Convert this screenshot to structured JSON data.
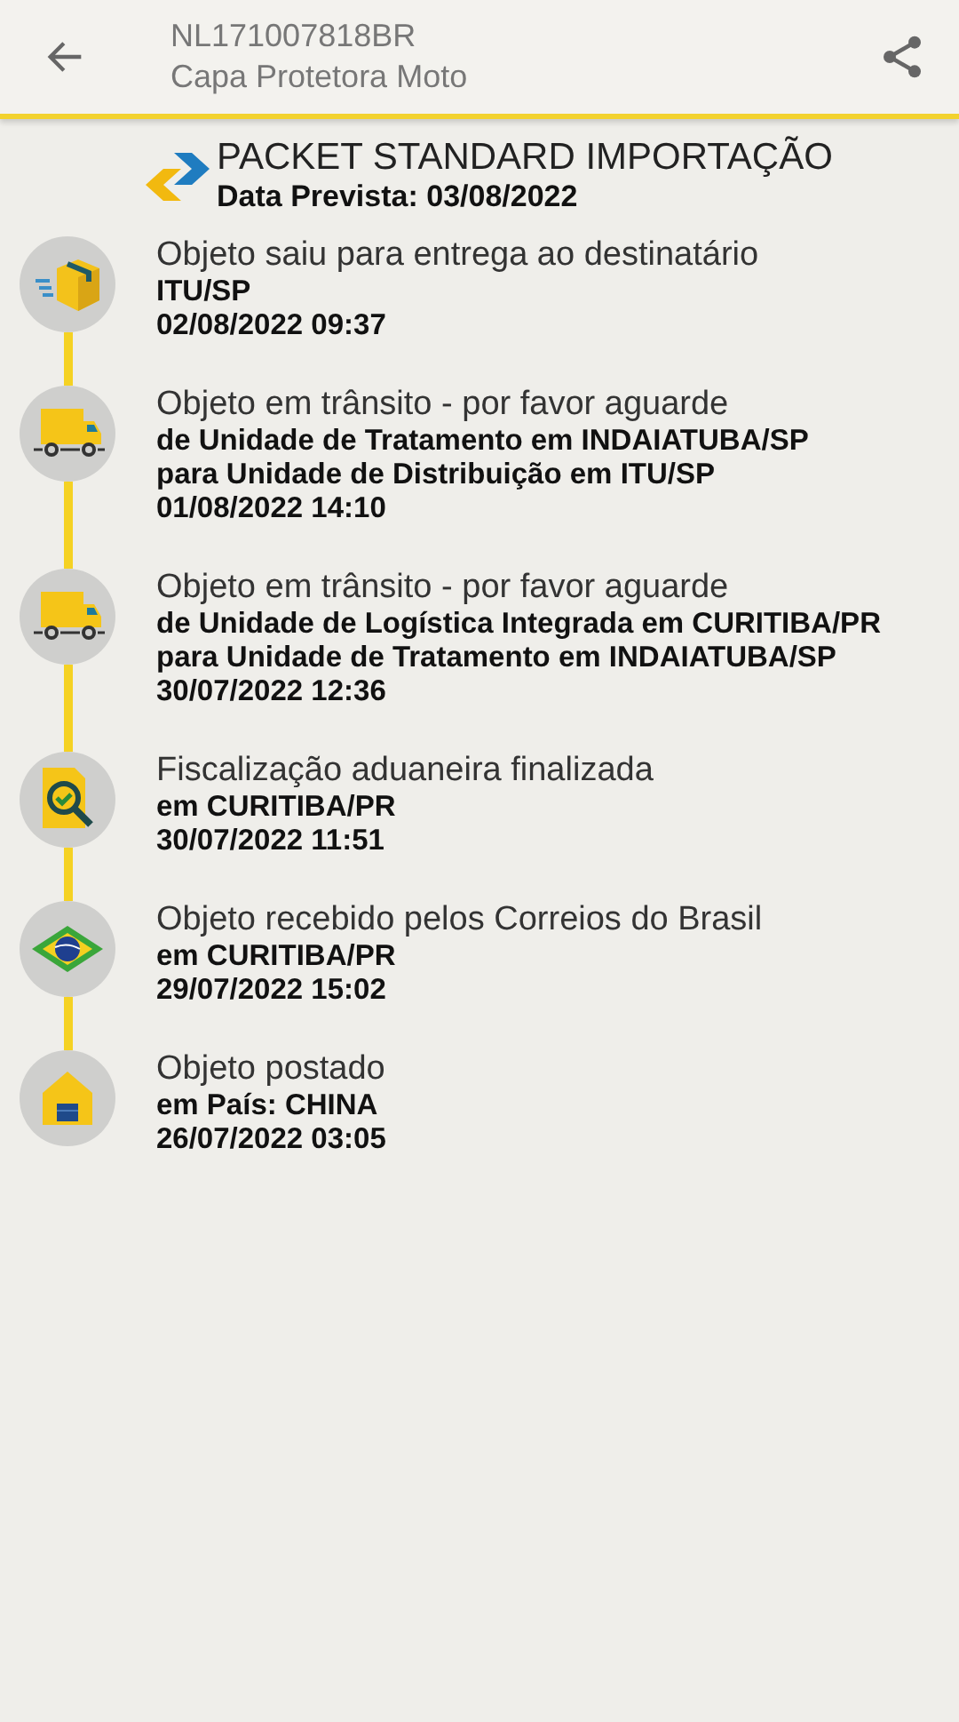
{
  "header": {
    "code": "NL171007818BR",
    "name": "Capa Protetora Moto"
  },
  "service": {
    "title": "PACKET STANDARD IMPORTAÇÃO",
    "forecast": "Data Prevista: 03/08/2022"
  },
  "events": [
    {
      "kind": "box",
      "title": "Objeto saiu para entrega ao destinatário",
      "lines": [
        "ITU/SP"
      ],
      "date": "02/08/2022 09:37"
    },
    {
      "kind": "truck",
      "title": "Objeto em trânsito - por favor aguarde",
      "lines": [
        "de Unidade de Tratamento em INDAIATUBA/SP",
        "para Unidade de Distribuição em ITU/SP"
      ],
      "date": "01/08/2022 14:10"
    },
    {
      "kind": "truck",
      "title": "Objeto em trânsito - por favor aguarde",
      "lines": [
        "de Unidade de Logística Integrada em CURITIBA/PR",
        "para Unidade de Tratamento em INDAIATUBA/SP"
      ],
      "date": "30/07/2022 12:36"
    },
    {
      "kind": "inspection",
      "title": "Fiscalização aduaneira finalizada",
      "lines": [
        "em CURITIBA/PR"
      ],
      "date": "30/07/2022 11:51"
    },
    {
      "kind": "flag",
      "title": "Objeto recebido pelos Correios do Brasil",
      "lines": [
        "em CURITIBA/PR"
      ],
      "date": "29/07/2022 15:02"
    },
    {
      "kind": "store",
      "title": "Objeto postado",
      "lines": [
        "em País: CHINA"
      ],
      "date": "26/07/2022 03:05"
    }
  ]
}
